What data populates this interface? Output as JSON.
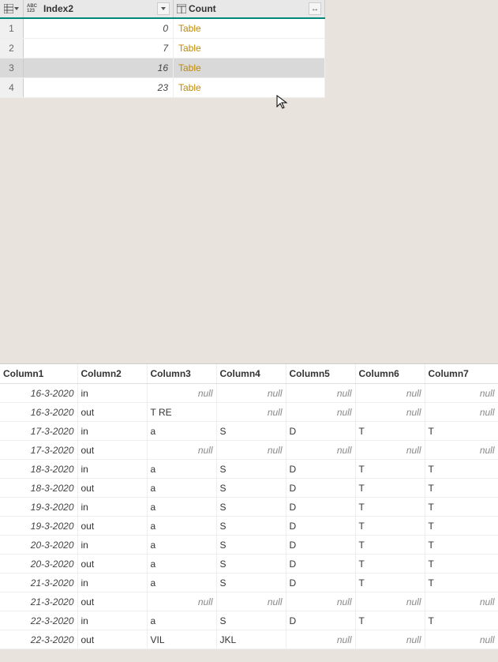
{
  "upper": {
    "columns": {
      "index2_label": "Index2",
      "count_label": "Count",
      "type_abc_top": "ABC",
      "type_abc_bottom": "123"
    },
    "rows": [
      {
        "idx": "1",
        "index2": "0",
        "count": "Table",
        "selected": false
      },
      {
        "idx": "2",
        "index2": "7",
        "count": "Table",
        "selected": false
      },
      {
        "idx": "3",
        "index2": "16",
        "count": "Table",
        "selected": true
      },
      {
        "idx": "4",
        "index2": "23",
        "count": "Table",
        "selected": false
      }
    ]
  },
  "preview": {
    "headers": [
      "Column1",
      "Column2",
      "Column3",
      "Column4",
      "Column5",
      "Column6",
      "Column7"
    ],
    "null_text": "null",
    "rows": [
      {
        "c1": "16-3-2020",
        "c2": "in",
        "c3": null,
        "c4": null,
        "c5": null,
        "c6": null,
        "c7": null
      },
      {
        "c1": "16-3-2020",
        "c2": "out",
        "c3": "T RE",
        "c4": null,
        "c5": null,
        "c6": null,
        "c7": null
      },
      {
        "c1": "17-3-2020",
        "c2": "in",
        "c3": "a",
        "c4": "S",
        "c5": "D",
        "c6": "T",
        "c7": "T"
      },
      {
        "c1": "17-3-2020",
        "c2": "out",
        "c3": null,
        "c4": null,
        "c5": null,
        "c6": null,
        "c7": null
      },
      {
        "c1": "18-3-2020",
        "c2": "in",
        "c3": "a",
        "c4": "S",
        "c5": "D",
        "c6": "T",
        "c7": "T"
      },
      {
        "c1": "18-3-2020",
        "c2": "out",
        "c3": "a",
        "c4": "S",
        "c5": "D",
        "c6": "T",
        "c7": "T"
      },
      {
        "c1": "19-3-2020",
        "c2": "in",
        "c3": "a",
        "c4": "S",
        "c5": "D",
        "c6": "T",
        "c7": "T"
      },
      {
        "c1": "19-3-2020",
        "c2": "out",
        "c3": "a",
        "c4": "S",
        "c5": "D",
        "c6": "T",
        "c7": "T"
      },
      {
        "c1": "20-3-2020",
        "c2": "in",
        "c3": "a",
        "c4": "S",
        "c5": "D",
        "c6": "T",
        "c7": "T"
      },
      {
        "c1": "20-3-2020",
        "c2": "out",
        "c3": "a",
        "c4": "S",
        "c5": "D",
        "c6": "T",
        "c7": "T"
      },
      {
        "c1": "21-3-2020",
        "c2": "in",
        "c3": "a",
        "c4": "S",
        "c5": "D",
        "c6": "T",
        "c7": "T"
      },
      {
        "c1": "21-3-2020",
        "c2": "out",
        "c3": null,
        "c4": null,
        "c5": null,
        "c6": null,
        "c7": null
      },
      {
        "c1": "22-3-2020",
        "c2": "in",
        "c3": "a",
        "c4": "S",
        "c5": "D",
        "c6": "T",
        "c7": "T"
      },
      {
        "c1": "22-3-2020",
        "c2": "out",
        "c3": "VIL",
        "c4": "JKL",
        "c5": null,
        "c6": null,
        "c7": null
      }
    ]
  }
}
